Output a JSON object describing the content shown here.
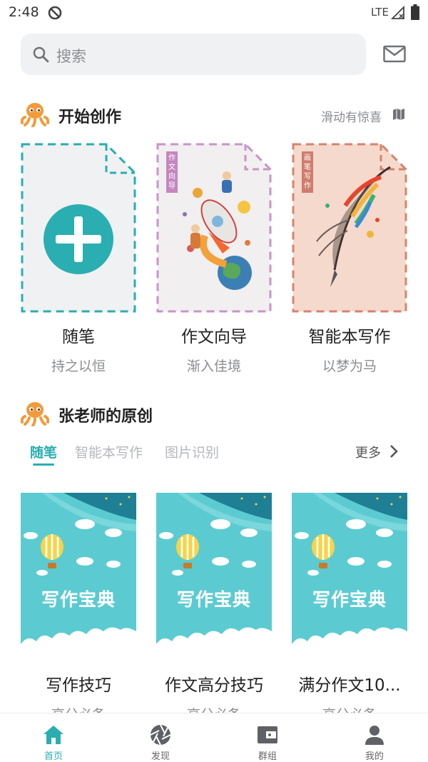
{
  "status_bar": {
    "time": "2:48",
    "network": "LTE"
  },
  "search": {
    "placeholder": "搜索"
  },
  "start_section": {
    "title": "开始创作",
    "hint": "滑动有惊喜",
    "cards": [
      {
        "label": "随笔",
        "subtitle": "持之以恒"
      },
      {
        "label": "作文向导",
        "subtitle": "渐入佳境",
        "ribbon": "作文向导"
      },
      {
        "label": "智能本写作",
        "subtitle": "以梦为马",
        "ribbon": "画笔写作"
      }
    ]
  },
  "original_section": {
    "title": "张老师的原创",
    "tabs": [
      "随笔",
      "智能本写作",
      "图片识别"
    ],
    "more": "更多",
    "items": [
      {
        "cover_text": "写作宝典",
        "title": "写作技巧",
        "subtitle": "高分必备"
      },
      {
        "cover_text": "写作宝典",
        "title": "作文高分技巧",
        "subtitle": "高分必备"
      },
      {
        "cover_text": "写作宝典",
        "title": "满分作文10...",
        "subtitle": "高分必备"
      }
    ]
  },
  "bottom_nav": {
    "items": [
      {
        "label": "首页",
        "icon": "home-icon",
        "active": true
      },
      {
        "label": "发现",
        "icon": "aperture-icon",
        "active": false
      },
      {
        "label": "群组",
        "icon": "wallet-icon",
        "active": false
      },
      {
        "label": "我的",
        "icon": "person-icon",
        "active": false
      }
    ]
  },
  "colors": {
    "accent": "#2aaeb1",
    "cover_bg": "#5ccbd1",
    "mascot": "#f29b3a"
  }
}
